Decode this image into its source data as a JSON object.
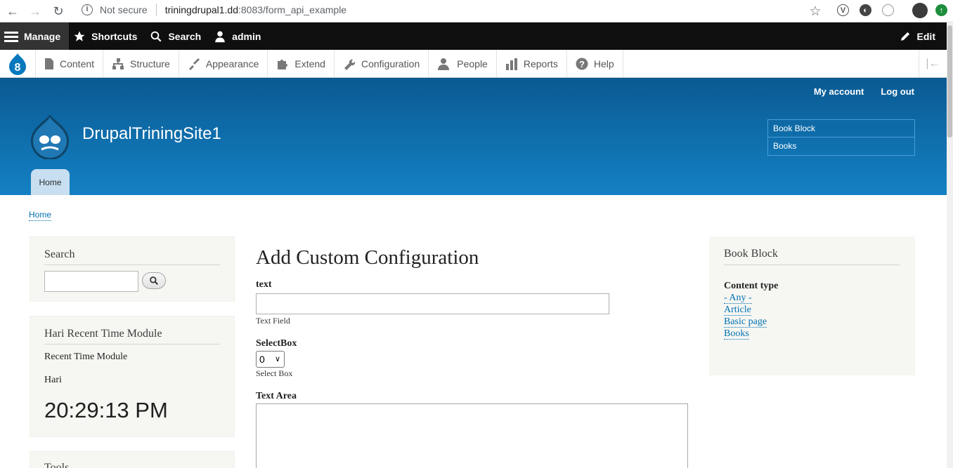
{
  "browser": {
    "security_label": "Not secure",
    "url_host": "triningdrupal1.dd",
    "url_path": ":8083/form_api_example"
  },
  "toolbar": {
    "manage": "Manage",
    "shortcuts": "Shortcuts",
    "search": "Search",
    "user": "admin",
    "edit": "Edit"
  },
  "admin_menu": {
    "items": [
      {
        "label": "Content",
        "icon": "file-icon"
      },
      {
        "label": "Structure",
        "icon": "structure-icon"
      },
      {
        "label": "Appearance",
        "icon": "paintbrush-icon"
      },
      {
        "label": "Extend",
        "icon": "puzzle-icon"
      },
      {
        "label": "Configuration",
        "icon": "wrench-icon"
      },
      {
        "label": "People",
        "icon": "people-icon"
      },
      {
        "label": "Reports",
        "icon": "bar-chart-icon"
      },
      {
        "label": "Help",
        "icon": "help-icon"
      }
    ]
  },
  "header": {
    "my_account": "My account",
    "log_out": "Log out",
    "site_name": "DrupalTriningSite1",
    "book_menu": [
      "Book Block",
      "Books"
    ],
    "home_tab": "Home"
  },
  "breadcrumb": "Home",
  "sidebar": {
    "search_title": "Search",
    "time_title": "Hari Recent Time Module",
    "time_subtitle": "Recent Time Module",
    "time_name": "Hari",
    "time_value": "20:29:13 PM",
    "tools_title": "Tools"
  },
  "form": {
    "title": "Add Custom Configuration",
    "text_label": "text",
    "text_desc": "Text Field",
    "select_label": "SelectBox",
    "select_value": "0",
    "select_desc": "Select Box",
    "textarea_label": "Text Area"
  },
  "book_block": {
    "title": "Book Block",
    "content_type_label": "Content type",
    "links": [
      "- Any -",
      "Article",
      "Basic page",
      "Books"
    ]
  },
  "colors": {
    "header_top": "#0a5a92",
    "header_bottom": "#1481c4",
    "link": "#0071b3"
  }
}
